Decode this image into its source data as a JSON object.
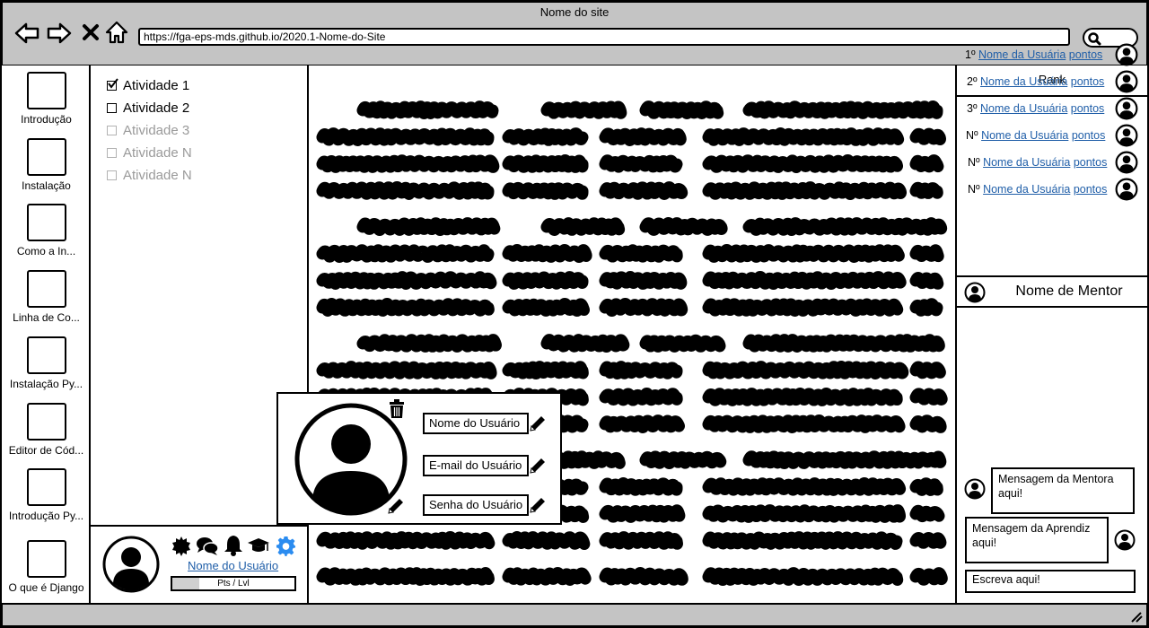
{
  "window": {
    "title": "Nome do site"
  },
  "browser": {
    "url": "https://fga-eps-mds.github.io/2020.1-Nome-do-Site"
  },
  "sidebar": {
    "items": [
      {
        "label": "Introdução"
      },
      {
        "label": "Instalação"
      },
      {
        "label": "Como a In..."
      },
      {
        "label": "Linha de Co..."
      },
      {
        "label": "Instalação Py..."
      },
      {
        "label": "Editor de Cód..."
      },
      {
        "label": "Introdução Py..."
      },
      {
        "label": "O que é Django"
      }
    ]
  },
  "activities": [
    {
      "label": "Atividade 1",
      "checked": true
    },
    {
      "label": "Atividade 2",
      "checked": false
    },
    {
      "label": "Atividade 3",
      "checked": false
    },
    {
      "label": "Atividade N",
      "checked": false
    },
    {
      "label": "Atividade N",
      "checked": false
    }
  ],
  "profile": {
    "username": "Nome do Usuário",
    "pts_label": "Pts / Lvl",
    "progress": 0.22,
    "accent": "#2b8cf0"
  },
  "popup": {
    "name_field": "Nome do Usuário",
    "email_field": "E-mail do Usuário",
    "password_field": "Senha do Usuário"
  },
  "rank": {
    "title": "Rank",
    "rows": [
      {
        "pos": "1º",
        "name": "Nome da Usuária",
        "points": "pontos"
      },
      {
        "pos": "2º",
        "name": "Nome da Usuária",
        "points": "pontos"
      },
      {
        "pos": "3º",
        "name": "Nome da Usuária",
        "points": "pontos"
      },
      {
        "pos": "Nº",
        "name": "Nome da Usuária",
        "points": "pontos"
      },
      {
        "pos": "Nº",
        "name": "Nome da Usuária",
        "points": "pontos"
      },
      {
        "pos": "Nº",
        "name": "Nome da Usuária",
        "points": "pontos"
      }
    ]
  },
  "mentor": {
    "name": "Nome de Mentor",
    "mentor_message": "Mensagem da Mentora aqui!",
    "learner_message": "Mensagem da Aprendiz aqui!",
    "input_placeholder": "Escreva aqui!"
  }
}
